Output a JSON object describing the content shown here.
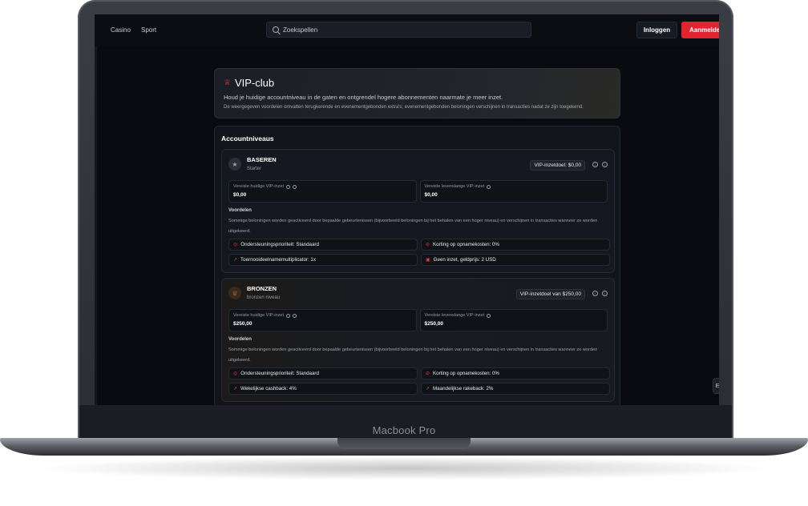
{
  "device": {
    "brand_label": "Macbook Pro"
  },
  "topbar": {
    "nav": [
      "Casino",
      "Sport"
    ],
    "search_placeholder": "Zoekspellen",
    "login_label": "Inloggen",
    "register_label": "Aanmelden"
  },
  "vip": {
    "title": "VIP-club",
    "subtitle": "Houd je huidige accountniveau in de gaten en ontgrendel hogere abonnementen naarmate je meer inzet.",
    "note": "De weergegeven voordelen omvatten terugkerende en evenementgebonden extra's; evenementgebonden beloningen verschijnen in transacties nadat ze zijn toegekend."
  },
  "levels_title": "Accountniveaus",
  "tiers": [
    {
      "name": "BASEREN",
      "desc": "Starter",
      "goal": "VIP-inzetdoel: $0,00",
      "current_label": "Vereiste huidige VIP-inzet",
      "current_value": "$0,00",
      "lifetime_label": "Vereiste levenslange VIP-inzet",
      "lifetime_value": "$0,00",
      "perks_title": "Voordelen",
      "perks_text": "Sommige beloningen worden geactiveerd door bepaalde gebeurtenissen (bijvoorbeeld beloningen bij het behalen van een hoger niveau) en verschijnen in transacties wanneer ze worden uitgekeerd.",
      "perks": [
        "Ondersteuningsprioriteit: Standaard",
        "Korting op opnamekosten: 0%",
        "Toernooideelnamemultiplicator: 1x",
        "Geen inzet, geldprijs: 2 USD"
      ]
    },
    {
      "name": "BRONZEN",
      "desc": "bronzen niveau",
      "goal": "VIP-inzetdoel van $250,00",
      "current_label": "Vereiste huidige VIP-inzet",
      "current_value": "$250,00",
      "lifetime_label": "Vereiste levenslange VIP-inzet",
      "lifetime_value": "$250,00",
      "perks_title": "Voordelen",
      "perks_text": "Sommige beloningen worden geactiveerd door bepaalde gebeurtenissen (bijvoorbeeld beloningen bij het behalen van een hoger niveau) en verschijnen in transacties wanneer ze worden uitgekeerd.",
      "perks": [
        "Ondersteuningsprioriteit: Standaard",
        "Korting op opnamekosten: 0%",
        "Wekelijkse cashback: 4%",
        "Maandelijkse rakeback: 2%"
      ]
    }
  ],
  "float_button_label": "E"
}
